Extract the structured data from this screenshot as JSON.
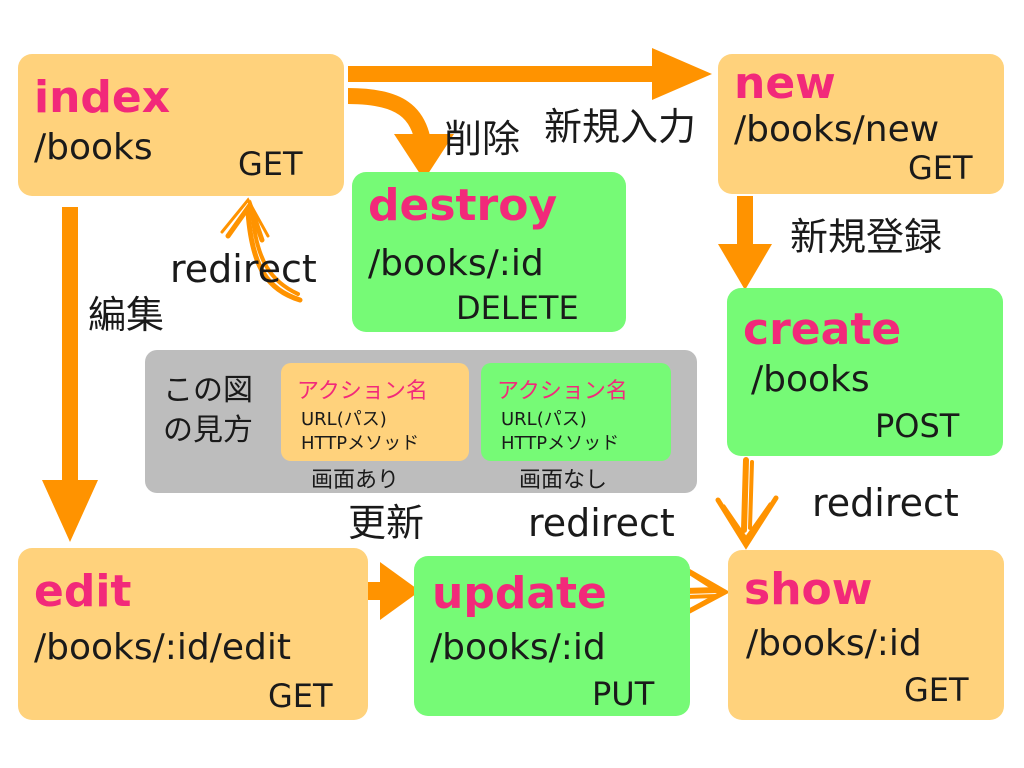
{
  "actions": {
    "index": {
      "name": "index",
      "path": "/books",
      "method": "GET"
    },
    "new": {
      "name": "new",
      "path": "/books/new",
      "method": "GET"
    },
    "destroy": {
      "name": "destroy",
      "path": "/books/:id",
      "method": "DELETE"
    },
    "create": {
      "name": "create",
      "path": "/books",
      "method": "POST"
    },
    "edit": {
      "name": "edit",
      "path": "/books/:id/edit",
      "method": "GET"
    },
    "update": {
      "name": "update",
      "path": "/books/:id",
      "method": "PUT"
    },
    "show": {
      "name": "show",
      "path": "/books/:id",
      "method": "GET"
    }
  },
  "edge_labels": {
    "index_to_new": "新規入力",
    "index_to_destroy": "削除",
    "new_to_create": "新規登録",
    "index_to_edit": "編集",
    "edit_to_update": "更新",
    "destroy_redirect": "redirect",
    "update_redirect": "redirect",
    "create_redirect": "redirect"
  },
  "legend": {
    "title_line1": "この図",
    "title_line2": "の見方",
    "with_screen": {
      "name": "アクション名",
      "line1": "URL(パス)",
      "line2": "HTTPメソッド",
      "caption": "画面あり"
    },
    "without_screen": {
      "name": "アクション名",
      "line1": "URL(パス)",
      "line2": "HTTPメソッド",
      "caption": "画面なし"
    }
  },
  "colors": {
    "screen_box": "#ffd27c",
    "no_screen_box": "#76fa76",
    "action_name": "#f2297a",
    "arrow": "#ff9300",
    "legend_bg": "#bdbdbd"
  }
}
